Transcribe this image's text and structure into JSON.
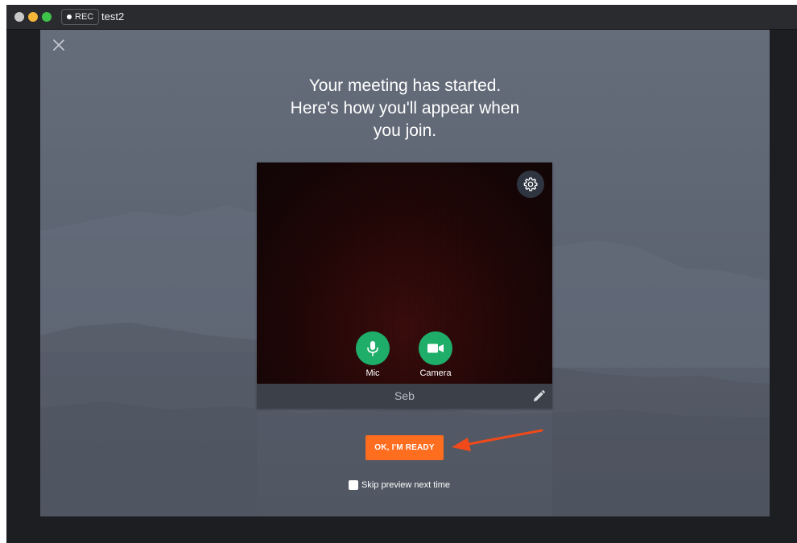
{
  "window": {
    "title": "test2",
    "rec_label": "REC"
  },
  "dialog": {
    "headline_line1": "Your meeting has started.",
    "headline_line2": "Here's how you'll appear when",
    "headline_line3": "you join.",
    "close_icon": "close-icon"
  },
  "preview": {
    "settings_icon": "gear-icon",
    "mic_label": "Mic",
    "camera_label": "Camera",
    "mic_enabled": true,
    "camera_enabled": true,
    "participant_name": "Seb",
    "edit_icon": "pencil-icon"
  },
  "actions": {
    "ready_label": "OK, I'M READY",
    "skip_label": "Skip preview next time",
    "skip_checked": false
  },
  "colors": {
    "accent": "#ff6d1f",
    "control_green": "#1fae6a",
    "annotation_arrow": "#f04a1a"
  }
}
